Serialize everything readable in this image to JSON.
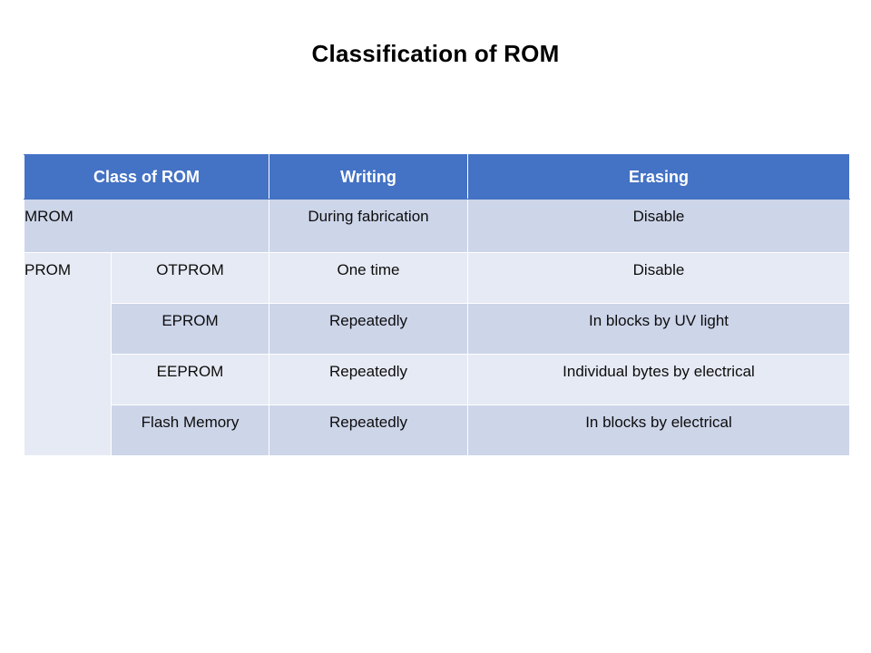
{
  "slide": {
    "title": "Classification of ROM",
    "background_color": "#FFFFFF",
    "title_color": "#000000"
  },
  "table": {
    "header_fill": "#4472C4",
    "header_text_color": "#FFFFFF",
    "row_fill_dark": "#CDD5E9",
    "row_fill_light": "#E6EAF4",
    "gridline_color": "#7C99CF",
    "columns": [
      {
        "id": "class",
        "label": "Class of ROM"
      },
      {
        "id": "writing",
        "label": "Writing"
      },
      {
        "id": "erasing",
        "label": "Erasing"
      }
    ],
    "groups": [
      {
        "id": "mrom",
        "label": "MROM",
        "spans_subcolumn": true,
        "rows": [
          {
            "id": "mrom",
            "name": "MROM",
            "writing": "During fabrication",
            "erasing": "Disable",
            "shade": "dark"
          }
        ]
      },
      {
        "id": "prom",
        "label": "PROM",
        "spans_subcolumn": false,
        "rows": [
          {
            "id": "otprom",
            "name": "OTPROM",
            "writing": "One time",
            "erasing": "Disable",
            "shade": "light"
          },
          {
            "id": "eprom",
            "name": "EPROM",
            "writing": "Repeatedly",
            "erasing": "In blocks by UV light",
            "shade": "dark"
          },
          {
            "id": "eeprom",
            "name": "EEPROM",
            "writing": "Repeatedly",
            "erasing": "Individual bytes by electrical",
            "shade": "light"
          },
          {
            "id": "flash",
            "name": "Flash Memory",
            "writing": "Repeatedly",
            "erasing": "In blocks by electrical",
            "shade": "dark"
          }
        ]
      }
    ]
  }
}
